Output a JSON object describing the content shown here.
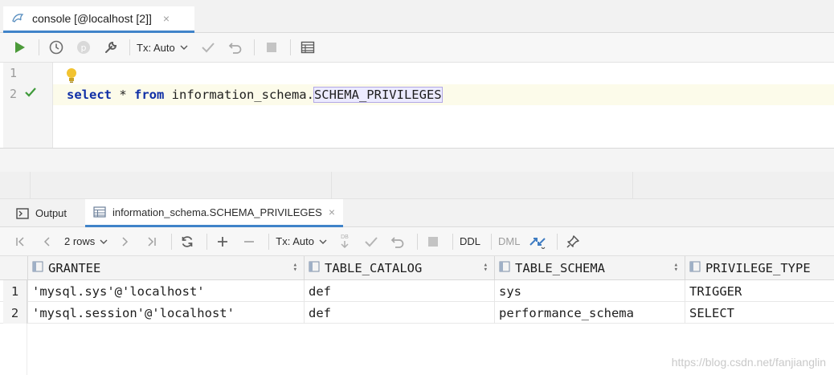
{
  "tab": {
    "title": "console [@localhost [2]]",
    "close": "×"
  },
  "toolbar": {
    "tx_mode": "Tx: Auto"
  },
  "editor": {
    "line_numbers": [
      "1",
      "2"
    ],
    "sql": {
      "kw_select": "select",
      "star": " * ",
      "kw_from": "from",
      "schema": " information_schema.",
      "table": "SCHEMA_PRIVILEGES"
    }
  },
  "results": {
    "tabs": [
      {
        "label": "Output"
      },
      {
        "label": "information_schema.SCHEMA_PRIVILEGES",
        "close": "×"
      }
    ],
    "toolbar": {
      "rows": "2 rows",
      "tx_mode": "Tx: Auto",
      "ddl": "DDL",
      "dml": "DML",
      "db": "DB"
    },
    "columns": [
      "GRANTEE",
      "TABLE_CATALOG",
      "TABLE_SCHEMA",
      "PRIVILEGE_TYPE"
    ],
    "rows": [
      {
        "n": "1",
        "cells": [
          "'mysql.sys'@'localhost'",
          "def",
          "sys",
          "TRIGGER"
        ]
      },
      {
        "n": "2",
        "cells": [
          "'mysql.session'@'localhost'",
          "def",
          "performance_schema",
          "SELECT"
        ]
      }
    ]
  },
  "watermark": "https://blog.csdn.net/fanjianglin",
  "colors": {
    "accent": "#4083c9",
    "keyword": "#0f2fa6",
    "run_green": "#4c9a3a"
  }
}
